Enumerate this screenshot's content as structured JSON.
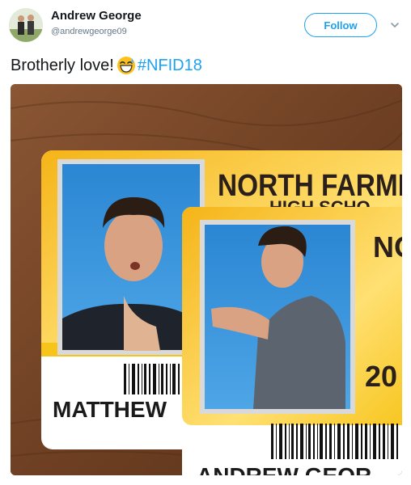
{
  "tweet": {
    "display_name": "Andrew George",
    "handle": "@andrewgeorge09",
    "follow_label": "Follow",
    "text": "Brotherly love!",
    "emoji": "grinning-sweat-emoji",
    "hashtag": "#NFID18"
  },
  "media": {
    "card_back": {
      "school_text": "NORTH FARMI",
      "second_line_fragment": "HIGH SCHO",
      "name_text": "MATTHEW"
    },
    "card_front": {
      "school_text": "NO",
      "year_text": "20",
      "name_text": "ANDREW GEOR"
    }
  },
  "colors": {
    "link_blue": "#1da1f2",
    "card_yellow": "#f7c41a",
    "photo_blue": "#2f8fd8",
    "table_wood": "#7a4a2a"
  }
}
